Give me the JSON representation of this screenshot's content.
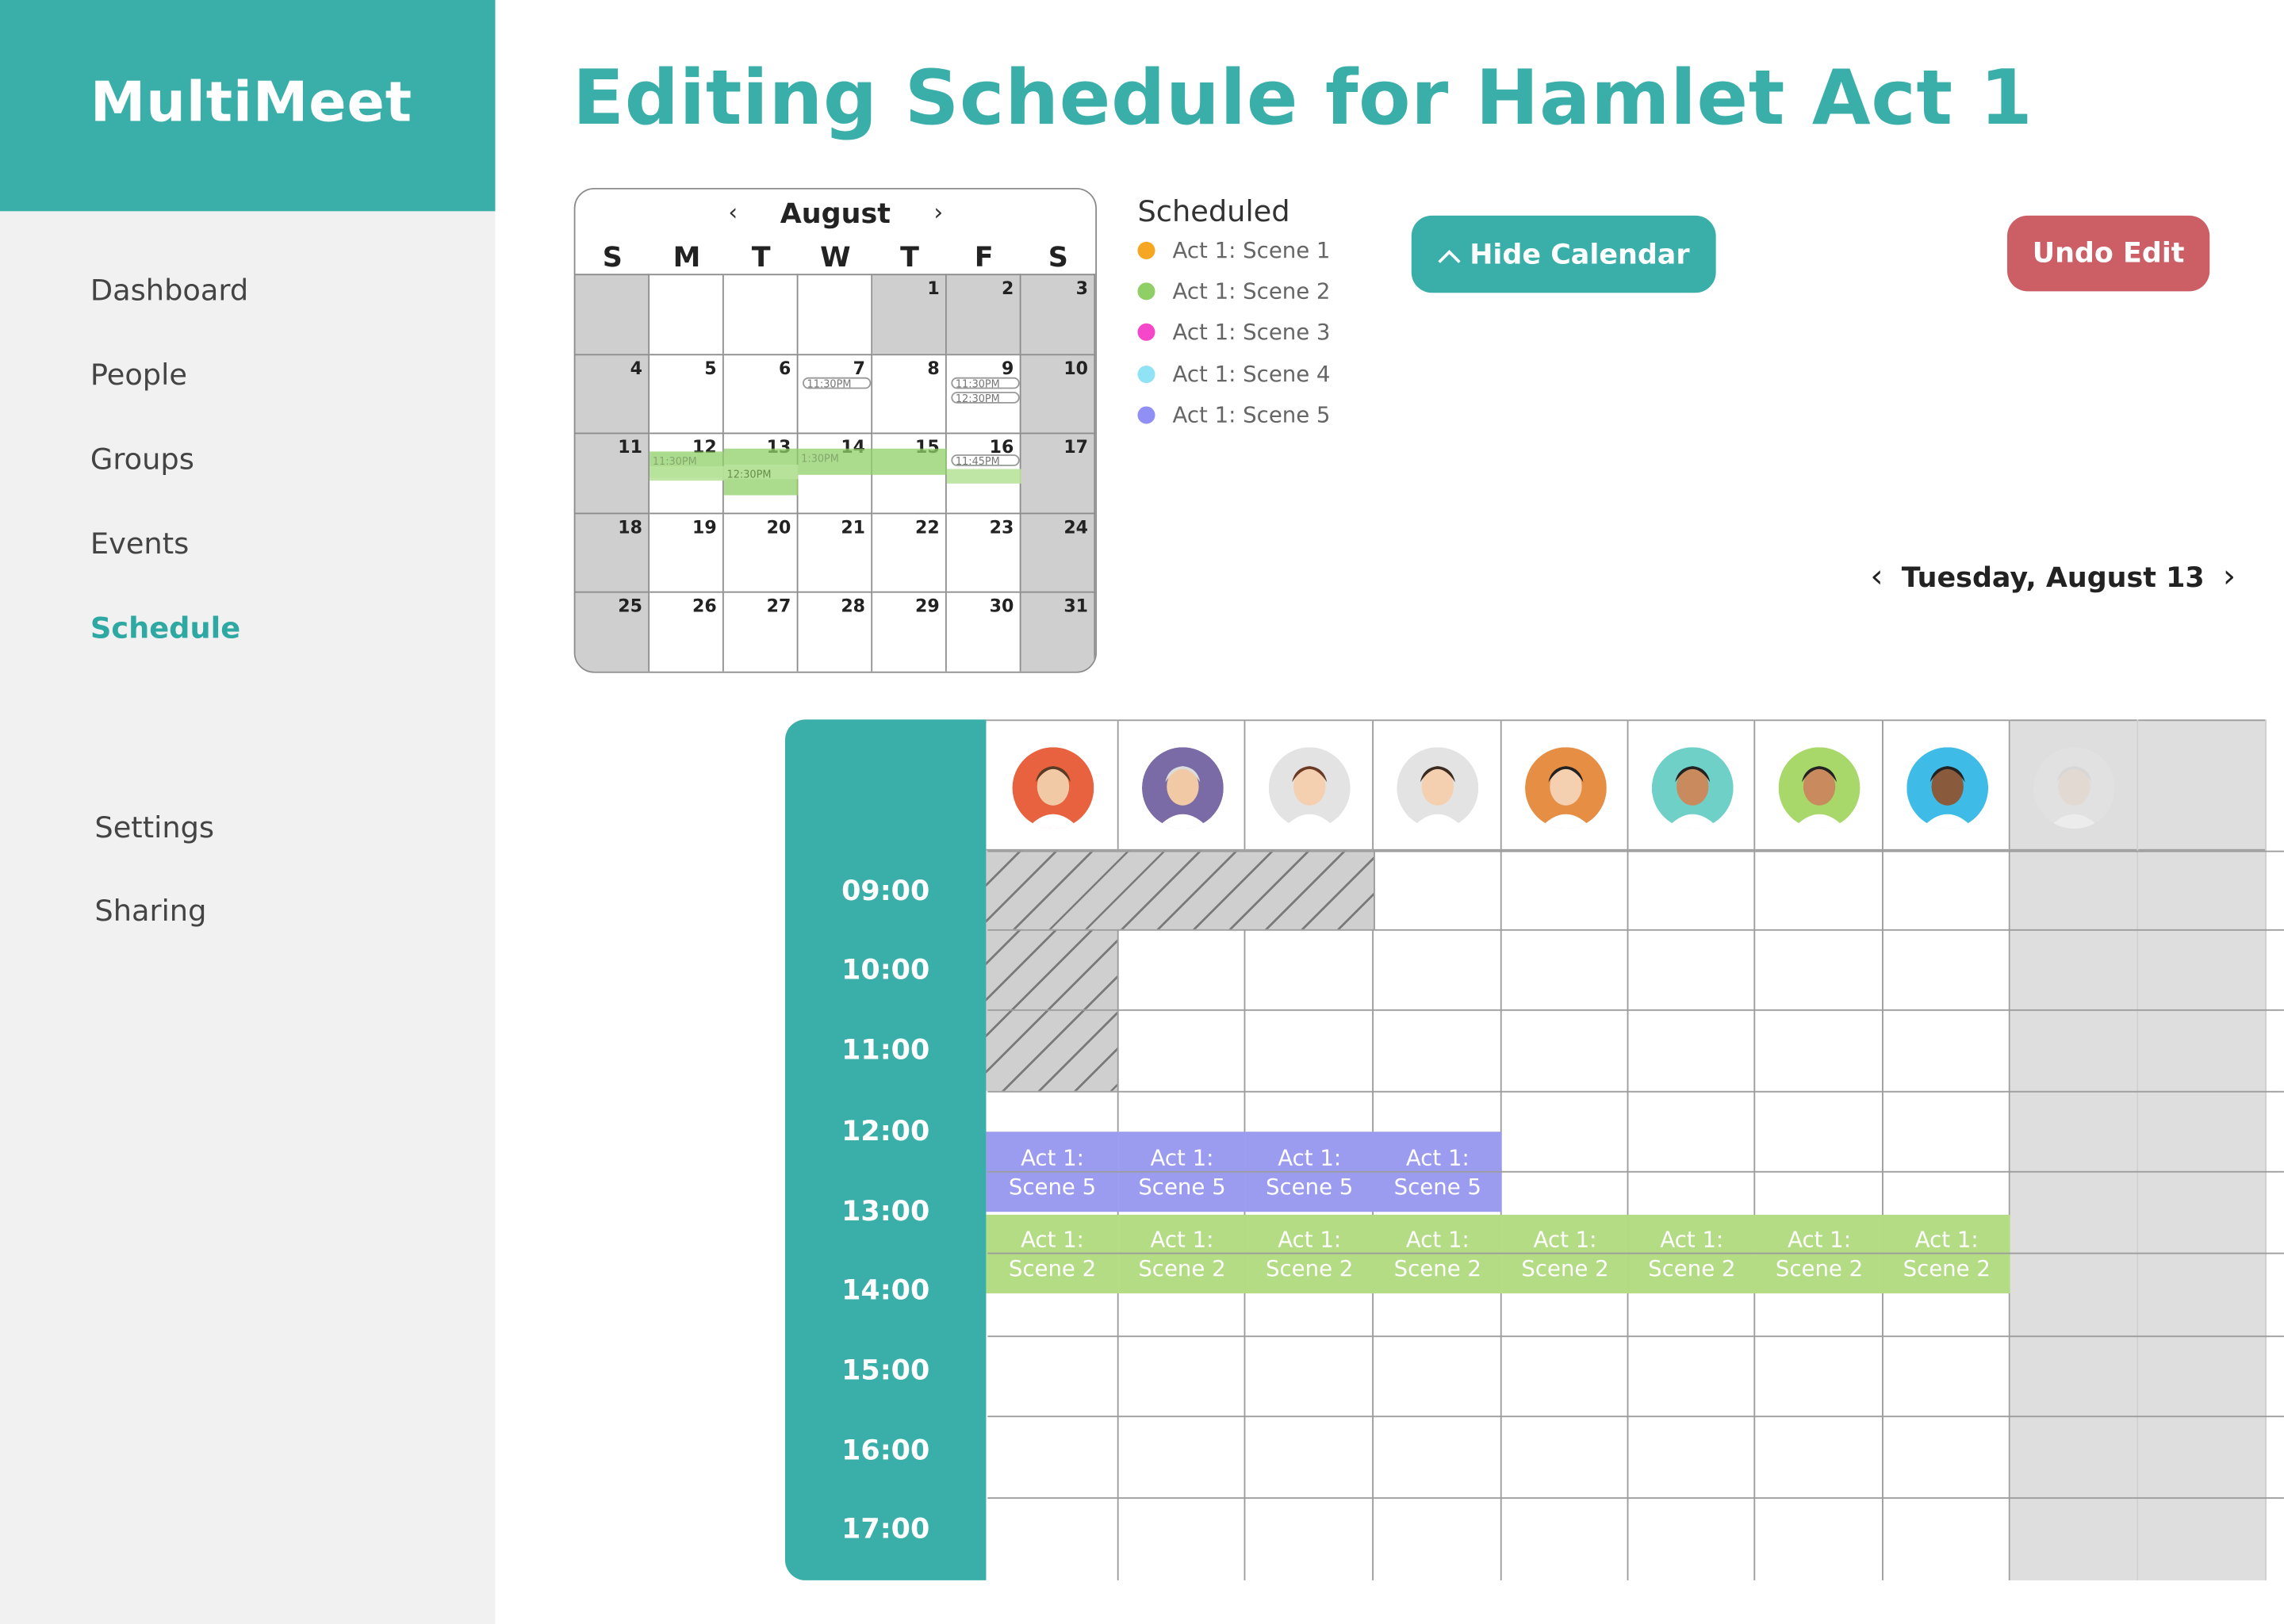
{
  "app": {
    "title": "MultiMeet"
  },
  "sidebar": {
    "items": [
      {
        "label": "Dashboard",
        "active": false
      },
      {
        "label": "People",
        "active": false
      },
      {
        "label": "Groups",
        "active": false
      },
      {
        "label": "Events",
        "active": false
      },
      {
        "label": "Schedule",
        "active": true
      }
    ],
    "bottom": [
      {
        "label": "Settings"
      },
      {
        "label": "Sharing"
      }
    ]
  },
  "page": {
    "title": "Editing Schedule for Hamlet Act 1"
  },
  "calendar": {
    "month": "August",
    "prev_glyph": "‹",
    "next_glyph": "›",
    "weekdays": [
      "S",
      "M",
      "T",
      "W",
      "T",
      "F",
      "S"
    ],
    "days": [
      1,
      2,
      3,
      4,
      5,
      6,
      7,
      8,
      9,
      10,
      11,
      12,
      13,
      14,
      15,
      16,
      17,
      18,
      19,
      20,
      21,
      22,
      23,
      24,
      25,
      26,
      27,
      28,
      29,
      30,
      31
    ],
    "pills": {
      "d7": "11:30PM",
      "d9a": "11:30PM",
      "d9b": "12:30PM",
      "d12": "11:30PM",
      "d12b": "12:30PM",
      "d13": "12:30PM",
      "d14": "1:30PM",
      "d16": "11:45PM"
    }
  },
  "legend": {
    "title": "Scheduled",
    "items": [
      {
        "label": "Act 1: Scene 1",
        "color": "#f5a623"
      },
      {
        "label": "Act 1: Scene 2",
        "color": "#8fcf66"
      },
      {
        "label": "Act 1: Scene 3",
        "color": "#f547c9"
      },
      {
        "label": "Act 1: Scene 4",
        "color": "#8fe3f5"
      },
      {
        "label": "Act 1: Scene 5",
        "color": "#8f8ff5"
      }
    ]
  },
  "buttons": {
    "hide_calendar": "Hide Calendar",
    "undo_edit": "Undo Edit"
  },
  "day_nav": {
    "date": "Tuesday, August 13",
    "prev": "‹",
    "next": "›"
  },
  "schedule": {
    "times": [
      "09:00",
      "10:00",
      "11:00",
      "12:00",
      "13:00",
      "14:00",
      "15:00",
      "16:00",
      "17:00"
    ],
    "scene5": {
      "line1": "Act 1:",
      "line2": "Scene 5"
    },
    "scene2": {
      "line1": "Act 1:",
      "line2": "Scene 2"
    }
  },
  "colors": {
    "accent": "#3aafa9",
    "undo": "#cc5f66",
    "scene5": "#9b9bf0",
    "scene2": "#b3dc85"
  }
}
